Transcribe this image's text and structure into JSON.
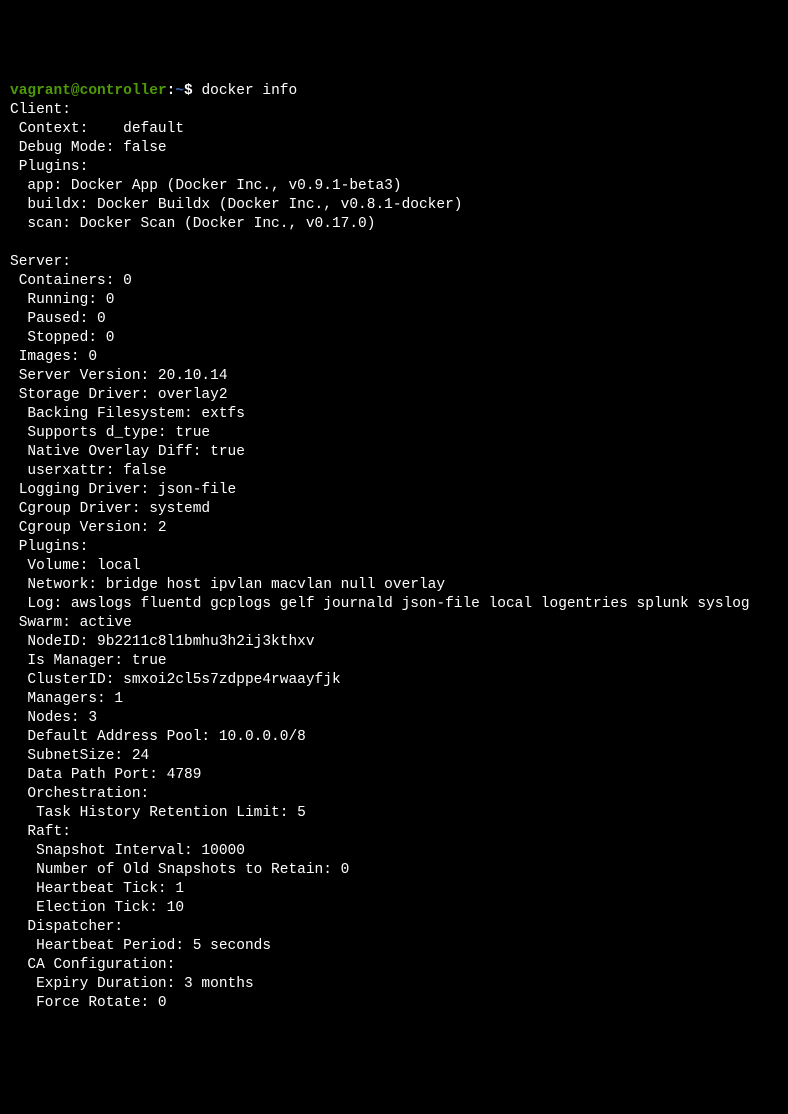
{
  "prompt": {
    "user": "vagrant",
    "at": "@",
    "host": "controller",
    "colon": ":",
    "tilde": "~",
    "dollar": "$",
    "command": " docker info"
  },
  "lines": [
    "Client:",
    " Context:    default",
    " Debug Mode: false",
    " Plugins:",
    "  app: Docker App (Docker Inc., v0.9.1-beta3)",
    "  buildx: Docker Buildx (Docker Inc., v0.8.1-docker)",
    "  scan: Docker Scan (Docker Inc., v0.17.0)",
    "",
    "Server:",
    " Containers: 0",
    "  Running: 0",
    "  Paused: 0",
    "  Stopped: 0",
    " Images: 0",
    " Server Version: 20.10.14",
    " Storage Driver: overlay2",
    "  Backing Filesystem: extfs",
    "  Supports d_type: true",
    "  Native Overlay Diff: true",
    "  userxattr: false",
    " Logging Driver: json-file",
    " Cgroup Driver: systemd",
    " Cgroup Version: 2",
    " Plugins:",
    "  Volume: local",
    "  Network: bridge host ipvlan macvlan null overlay",
    "  Log: awslogs fluentd gcplogs gelf journald json-file local logentries splunk syslog",
    " Swarm: active",
    "  NodeID: 9b2211c8l1bmhu3h2ij3kthxv",
    "  Is Manager: true",
    "  ClusterID: smxoi2cl5s7zdppe4rwaayfjk",
    "  Managers: 1",
    "  Nodes: 3",
    "  Default Address Pool: 10.0.0.0/8",
    "  SubnetSize: 24",
    "  Data Path Port: 4789",
    "  Orchestration:",
    "   Task History Retention Limit: 5",
    "  Raft:",
    "   Snapshot Interval: 10000",
    "   Number of Old Snapshots to Retain: 0",
    "   Heartbeat Tick: 1",
    "   Election Tick: 10",
    "  Dispatcher:",
    "   Heartbeat Period: 5 seconds",
    "  CA Configuration:",
    "   Expiry Duration: 3 months",
    "   Force Rotate: 0"
  ]
}
